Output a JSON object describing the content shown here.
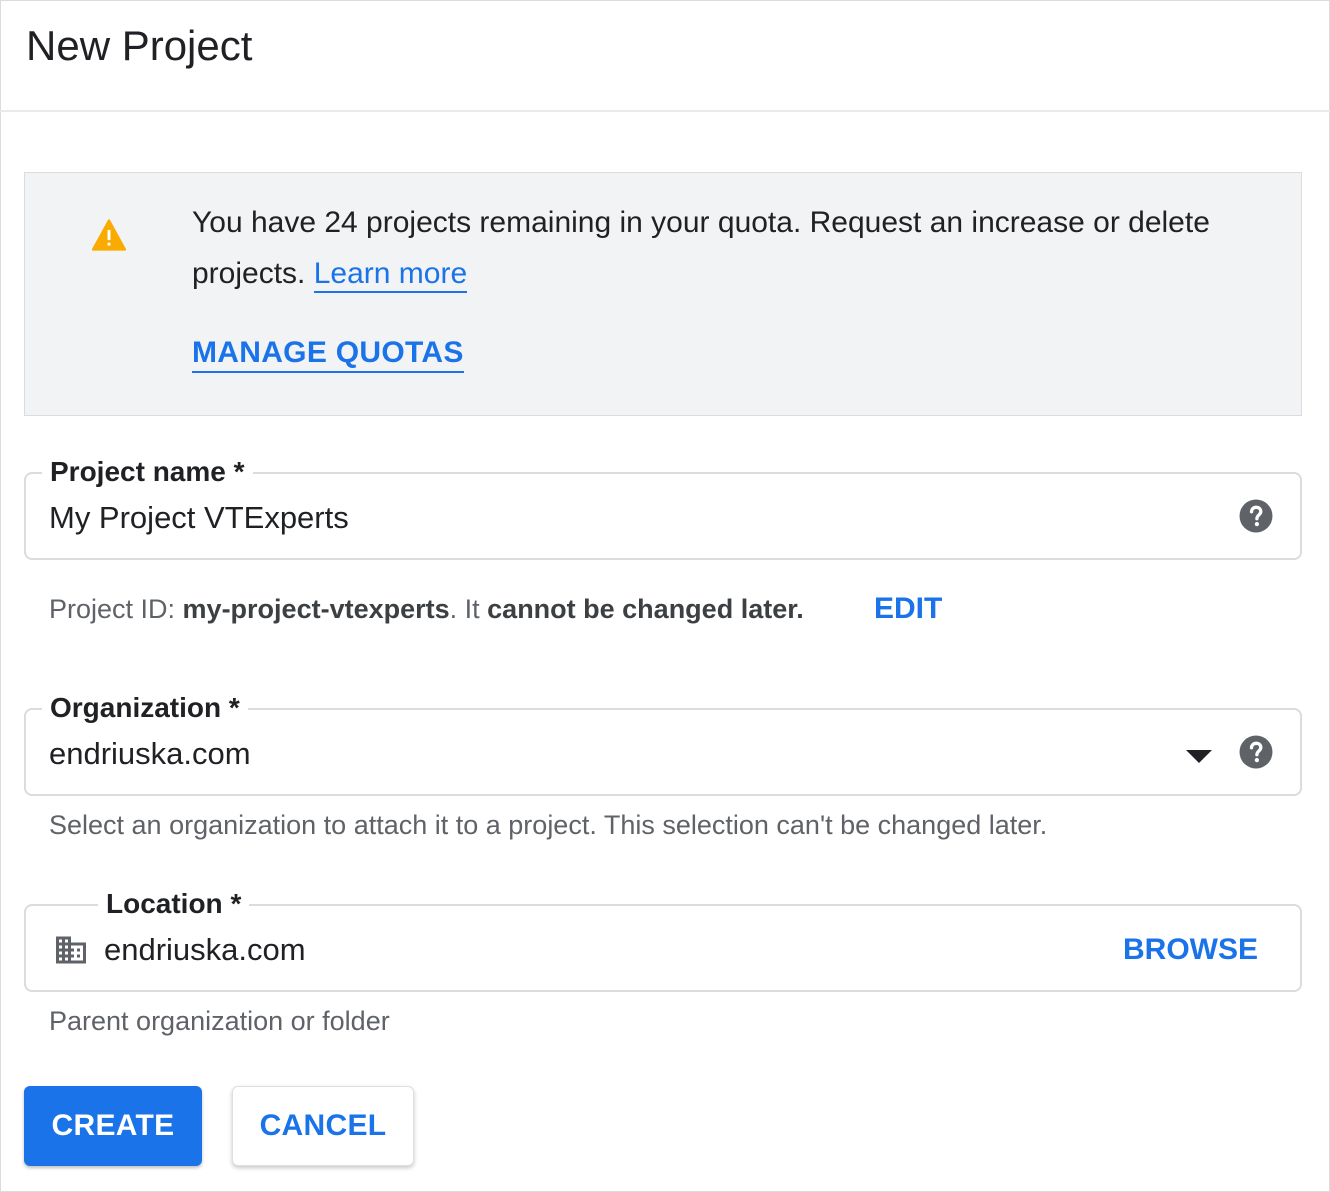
{
  "dialog": {
    "title": "New Project"
  },
  "quota_banner": {
    "message": "You have 24 projects remaining in your quota. Request an increase or delete projects.",
    "learn_more_label": "Learn more",
    "manage_quotas_label": "MANAGE QUOTAS",
    "icon": "warning-icon",
    "icon_color": "#f9ab00"
  },
  "project_name": {
    "label": "Project name *",
    "value": "My Project VTExperts",
    "help_icon": "help-icon"
  },
  "project_id": {
    "prefix": "Project ID: ",
    "id": "my-project-vtexperts",
    "middle": ". It ",
    "suffix": "cannot be changed later.",
    "edit_label": "EDIT"
  },
  "organization": {
    "label": "Organization *",
    "value": "endriuska.com",
    "hint": "Select an organization to attach it to a project. This selection can't be changed later.",
    "help_icon": "help-icon"
  },
  "location": {
    "label": "Location *",
    "value": "endriuska.com",
    "browse_label": "BROWSE",
    "hint": "Parent organization or folder",
    "icon": "building-icon"
  },
  "actions": {
    "create_label": "CREATE",
    "cancel_label": "CANCEL"
  },
  "colors": {
    "accent": "#1a73e8",
    "banner_bg": "#f1f3f4",
    "warning": "#f9ab00"
  }
}
